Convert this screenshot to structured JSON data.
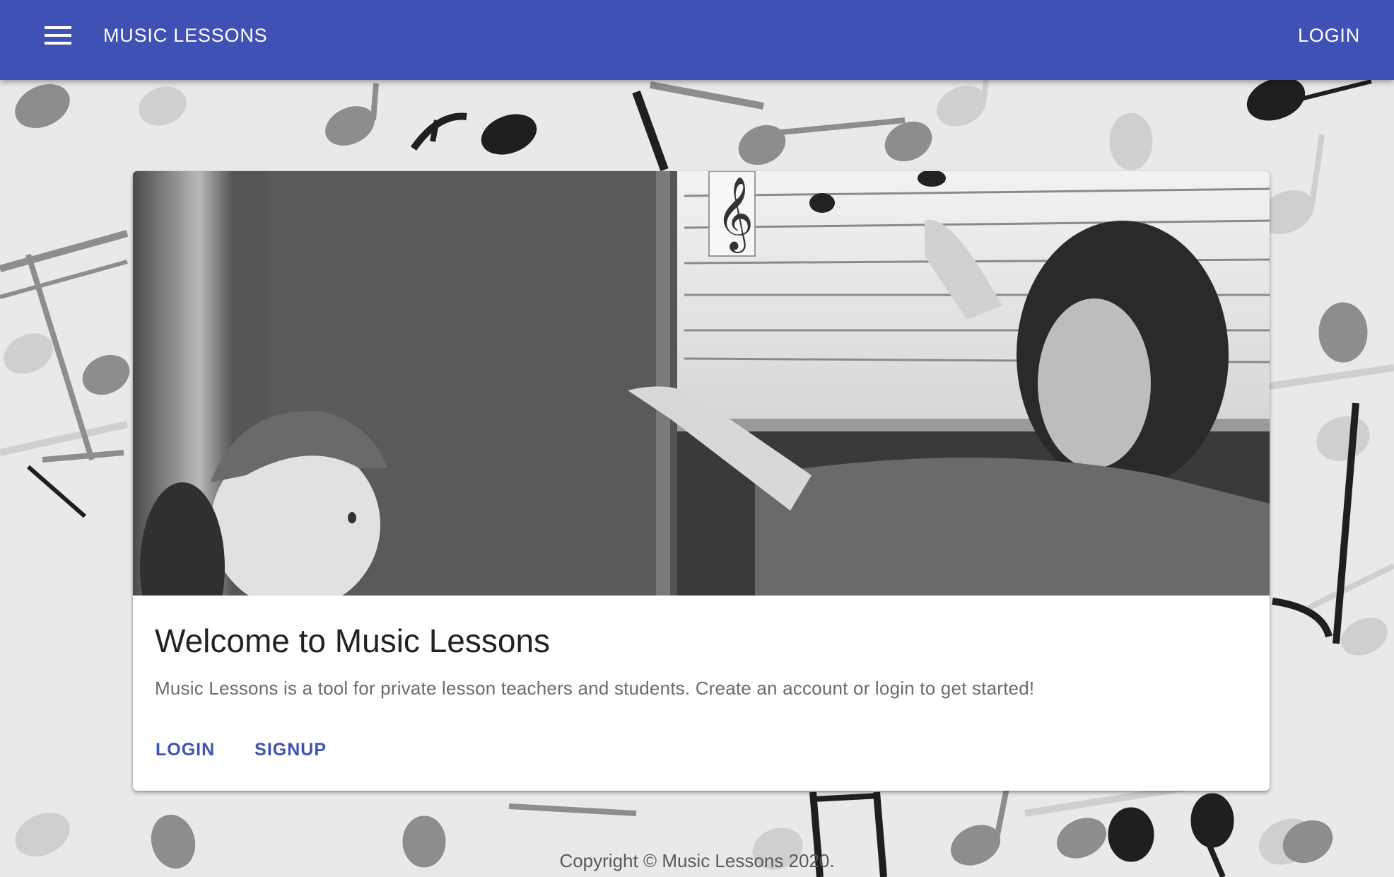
{
  "appbar": {
    "menu_icon": "menu-icon",
    "title": "MUSIC LESSONS",
    "login_label": "LOGIN",
    "color": "#3f51b5"
  },
  "card": {
    "image": "teacher-and-student-at-blackboard-photo",
    "title": "Welcome to Music Lessons",
    "text": "Music Lessons is a tool for private lesson teachers and students. Create an account or login to get started!",
    "actions": {
      "login_label": "LOGIN",
      "signup_label": "SIGNUP"
    }
  },
  "footer": {
    "text": "Copyright © Music Lessons 2020."
  },
  "background": {
    "pattern": "music-notes-pattern"
  }
}
